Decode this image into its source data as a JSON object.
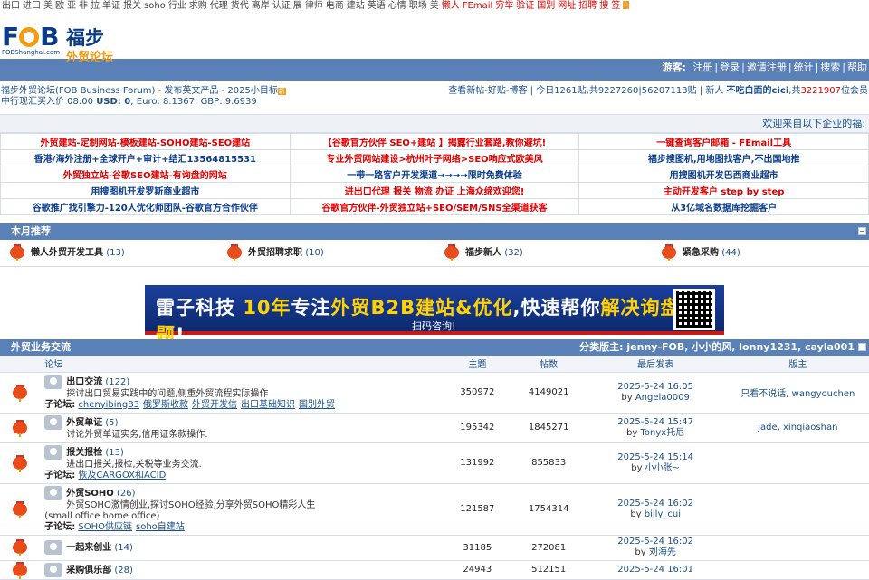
{
  "topnav": {
    "items": [
      "出口",
      "进口",
      "美",
      "欧",
      "亚",
      "非",
      "拉",
      "单证",
      "报关",
      "soho",
      "行业",
      "求购",
      "代理",
      "货代",
      "离岸",
      "认证",
      "展",
      "律师",
      "电商",
      "建站",
      "英语",
      "心情",
      "职场",
      "美"
    ],
    "hot_items": [
      "懒人",
      "FEmail",
      "穷举",
      "验证",
      "国别",
      "网址",
      "招聘",
      "搜",
      "签"
    ]
  },
  "logo": {
    "brand": "FOB",
    "sub": "FOBShanghai.com",
    "cn_name": "福步",
    "cn_tag": "外贸论坛"
  },
  "userbar": {
    "guest": "游客:",
    "links": [
      "注册",
      "登录",
      "邀请注册",
      "统计",
      "搜索",
      "帮助"
    ]
  },
  "info": {
    "forum_title": "福步外贸论坛(FOB Business Forum)",
    "tagline": "- 发布英文产品 - 2025小目标",
    "new_badge": "新",
    "rate_label": "中行现汇买入价 08:00",
    "usd": "USD: 0",
    "eur": "; Euro: 8.1367;",
    "gbp": "GBP: 9.6939",
    "right_links": "查看新帖-好贴-博客 | 今日1261贴,共9227260|56207113贴 | 新人",
    "newbie": "不吃白面的cici",
    "member_count_pre": ",共",
    "member_count": "3221907",
    "member_count_post": "位会员"
  },
  "welcome": "欢迎来自以下企业的福:",
  "ads": [
    [
      {
        "t": "外贸建站-定制网站-模板建站-SOHO建站-SEO建站",
        "c": "red"
      },
      {
        "t": "【谷歌官方伙伴 SEO+建站 】揭露行业套路,教你避坑!",
        "c": "red"
      },
      {
        "t": "一键查询客户邮箱 - FEmail工具",
        "c": "red"
      }
    ],
    [
      {
        "t": "香港/海外注册+全球开户+审计+结汇13564815531",
        "c": "blue"
      },
      {
        "t": "专业外贸网站建设>杭州叶子网络>SEO响应式欧美风",
        "c": "red"
      },
      {
        "t": "福步搜图机,用地图找客户,不出国地推",
        "c": "blue"
      }
    ],
    [
      {
        "t": "外贸独立站-谷歌SEO建站-有询盘的网站",
        "c": "red"
      },
      {
        "t": "一带一路客户开发渠道→→→→限时免费体验",
        "c": "blue"
      },
      {
        "t": "用搜图机开发巴西商业超市",
        "c": "blue"
      }
    ],
    [
      {
        "t": "用搜图机开发罗斯商业超市",
        "c": "blue"
      },
      {
        "t": "进出口代理 报关 物流 办证 上海众缔欢迎您!",
        "c": "red"
      },
      {
        "t": "主动开发客户 step by step",
        "c": "red"
      }
    ],
    [
      {
        "t": "谷歌推广找引擎力-120人优化师团队-谷歌官方合作伙伴",
        "c": "blue"
      },
      {
        "t": "谷歌官方伙伴-外贸独立站+SEO/SEM/SNS全渠道获客",
        "c": "red"
      },
      {
        "t": "从3亿域名数据库挖掘客户",
        "c": "blue"
      }
    ]
  ],
  "monthly": {
    "title": "本月推荐",
    "items": [
      {
        "name": "懒人外贸开发工具",
        "count": "(13)"
      },
      {
        "name": "外贸招聘求职",
        "count": "(10)"
      },
      {
        "name": "福步新人",
        "count": "(32)"
      },
      {
        "name": "紧急采购",
        "count": "(44)"
      }
    ]
  },
  "banner": {
    "p1": "雷子科技 ",
    "p2": "10年",
    "p3": "专注",
    "p4": "外贸B2B建站&优化",
    "p5": ",快速帮你",
    "p6": "解决询盘难题",
    "p7": "!",
    "sub": "扫码咨询!"
  },
  "forum_section": {
    "title": "外贸业务交流",
    "mods": "分类版主: jenny-FOB, 小小的风, lonny1231, cayla001",
    "headers": [
      "论坛",
      "主题",
      "帖数",
      "最后发表",
      "版主"
    ],
    "rows": [
      {
        "name": "出口交流",
        "count": "(122)",
        "desc": "探讨出口贸易实践中的问题,侧重外贸流程实际操作",
        "sub_label": "子论坛:",
        "subs": [
          "chenyibing83",
          "俄罗斯收款",
          "外贸开发信",
          "出口基础知识",
          "国别外贸"
        ],
        "topics": "350972",
        "posts": "4149021",
        "date": "2025-5-24 16:05",
        "by": "by",
        "user": "Angela0009",
        "mods": "只看不说话, wangyouchen"
      },
      {
        "name": "外贸单证",
        "count": "(5)",
        "desc": "讨论外贸单证实务,信用证条款操作.",
        "sub_label": "",
        "subs": [],
        "topics": "195342",
        "posts": "1845271",
        "date": "2025-5-24 15:47",
        "by": "by",
        "user": "Tonyx托尼",
        "mods": "jade, xinqiaoshan"
      },
      {
        "name": "报关报检",
        "count": "(13)",
        "desc": "进出口报关,报检,关税等业务交流.",
        "sub_label": "子论坛:",
        "subs": [
          "恢及CARGOX和ACID"
        ],
        "topics": "131992",
        "posts": "855833",
        "date": "2025-5-24 15:14",
        "by": "by",
        "user": "小小张~",
        "mods": ""
      },
      {
        "name": "外贸SOHO",
        "count": "(26)",
        "desc": "外贸SOHO激情创业,探讨SOHO经验,分享外贸SOHO精彩人生",
        "desc2": "(small office home office)",
        "sub_label": "子论坛:",
        "subs": [
          "SOHO供应链",
          "soho自建站"
        ],
        "topics": "121587",
        "posts": "1754314",
        "date": "2025-5-24 16:02",
        "by": "by",
        "user": "billy_cui",
        "mods": ""
      },
      {
        "name": "一起来创业",
        "count": "(14)",
        "desc": "",
        "sub_label": "",
        "subs": [],
        "topics": "31185",
        "posts": "272081",
        "date": "2025-5-24 16:02",
        "by": "by",
        "user": "刘海先",
        "mods": ""
      },
      {
        "name": "采购俱乐部",
        "count": "(28)",
        "desc": "",
        "sub_label": "",
        "subs": [],
        "topics": "24943",
        "posts": "512151",
        "date": "2025-5-24 16:01",
        "by": "",
        "user": "",
        "mods": ""
      }
    ]
  }
}
